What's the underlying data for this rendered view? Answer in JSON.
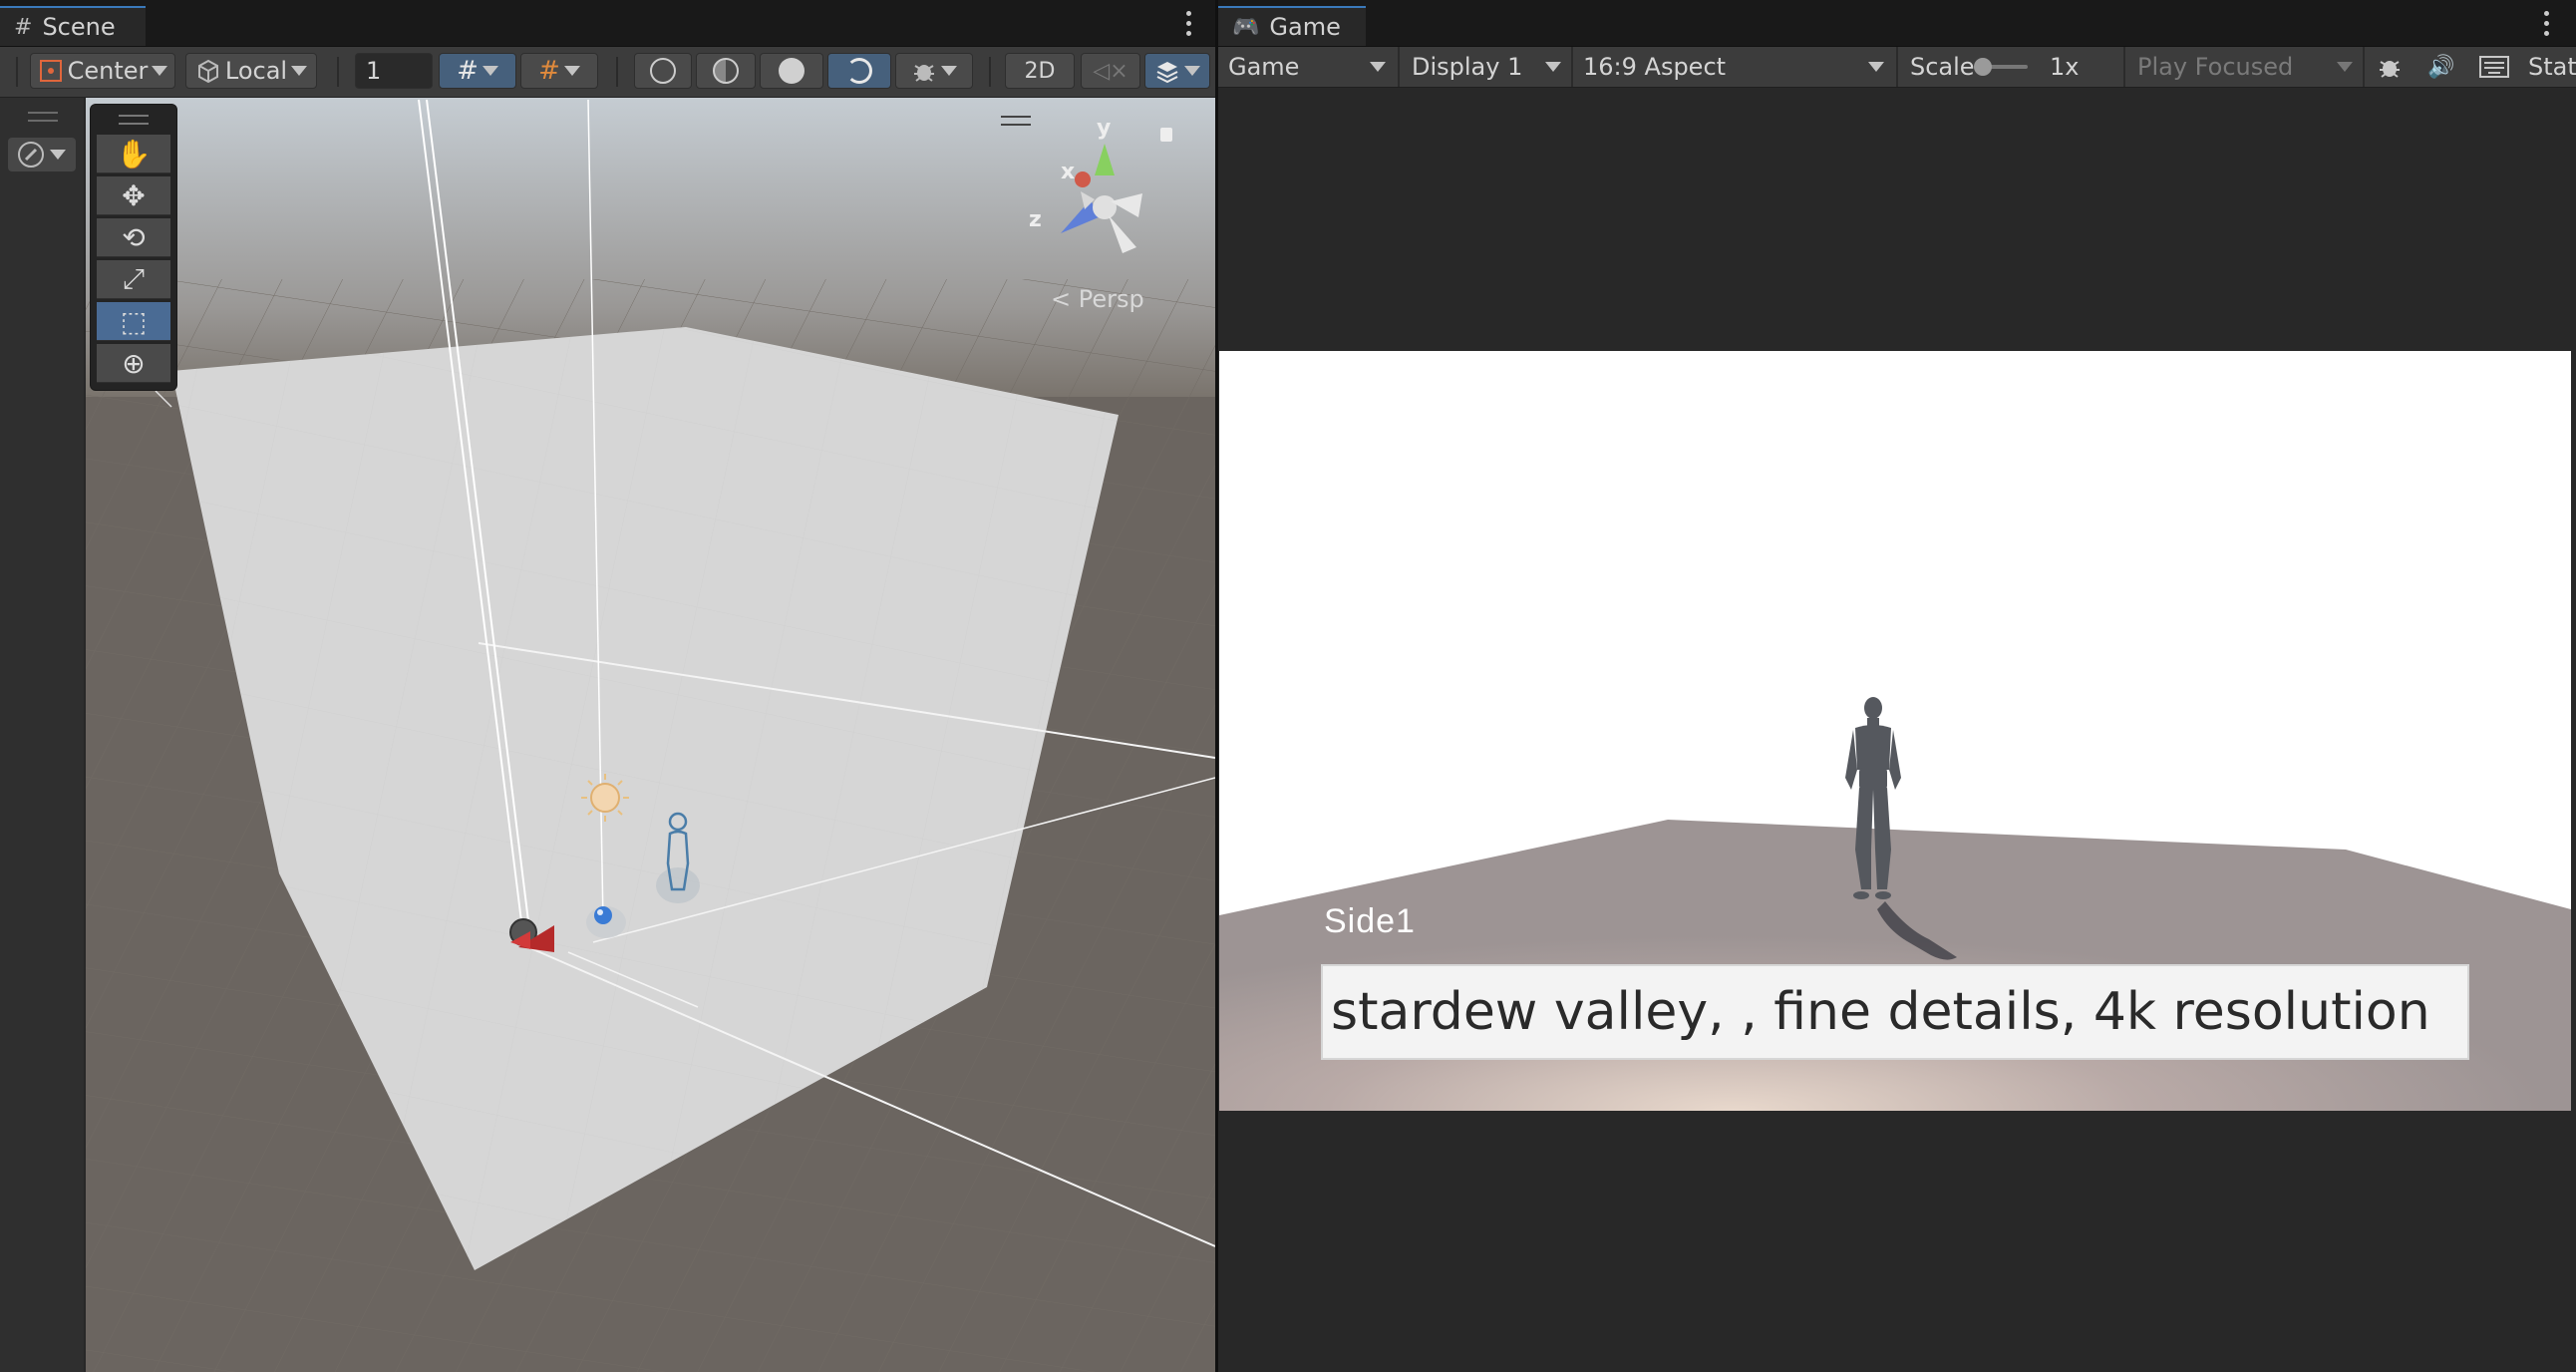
{
  "scene": {
    "tab_title": "Scene",
    "toolbar": {
      "pivot_label": "Center",
      "space_label": "Local",
      "grid_size_value": "1",
      "mode_2d_label": "2D"
    },
    "persp_label": "Persp",
    "gizmo_axes": {
      "x": "x",
      "y": "y",
      "z": "z"
    }
  },
  "game": {
    "tab_title": "Game",
    "toolbar": {
      "view_mode": "Game",
      "display": "Display 1",
      "aspect": "16:9 Aspect",
      "scale_label": "Scale",
      "scale_value": "1x",
      "play_mode": "Play Focused",
      "stats_label": "Stats"
    },
    "overlay": {
      "side_label": "Side1",
      "prompt_text": "stardew valley, , fine details, 4k resolution"
    }
  },
  "colors": {
    "accent_blue": "#3a79bb",
    "active_tool": "#4a6b94",
    "panel_bg": "#282828",
    "toolbar_bg": "#3c3c3c"
  },
  "icons": {
    "scene_tab": "grid-hash-icon",
    "game_tab": "gamepad-icon",
    "tools": [
      "hand-icon",
      "move-icon",
      "rotate-icon",
      "scale-icon",
      "rect-tool-icon",
      "transform-icon"
    ]
  }
}
